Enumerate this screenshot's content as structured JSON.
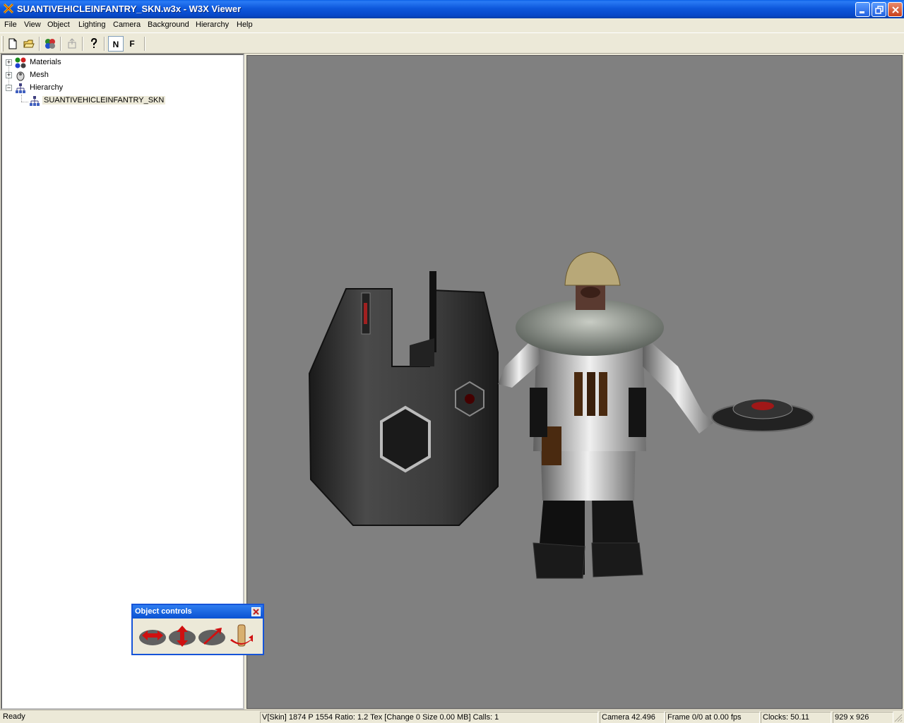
{
  "window": {
    "title": "SUANTIVEHICLEINFANTRY_SKN.w3x - W3X Viewer",
    "icon": "w3x-app-icon",
    "controls": [
      "minimize-icon",
      "restore-icon",
      "close-icon"
    ]
  },
  "menu": {
    "items": [
      "File",
      "View",
      "Object",
      "Lighting",
      "Camera",
      "Background",
      "Hierarchy",
      "Help"
    ]
  },
  "toolbar": {
    "tools": [
      "new-file-icon",
      "open-folder-icon",
      "export-icon",
      "disabled-tool-icon",
      "help-icon"
    ],
    "n_label": "N",
    "f_label": "F"
  },
  "tree": {
    "materials": "Materials",
    "mesh": "Mesh",
    "hierarchy": "Hierarchy",
    "hierarchy_child": "SUANTIVEHICLEINFANTRY_SKN"
  },
  "object_controls": {
    "title": "Object controls",
    "buttons": [
      "move-horizontal-icon",
      "move-vertical-icon",
      "move-diagonal-icon",
      "rotate-icon"
    ]
  },
  "status": {
    "ready": "Ready",
    "stats": "V[Skin] 1874 P 1554 Ratio: 1.2 Tex [Change 0 Size 0.00 MB] Calls: 1",
    "camera": "Camera 42.496",
    "frame": "Frame 0/0 at 0.00 fps",
    "clocks": "Clocks: 50.11",
    "resolution": "929 x 926"
  },
  "colors": {
    "viewport_bg": "#808080",
    "titlebar_blue": "#0a52d2",
    "arrow_red": "#d01010"
  }
}
